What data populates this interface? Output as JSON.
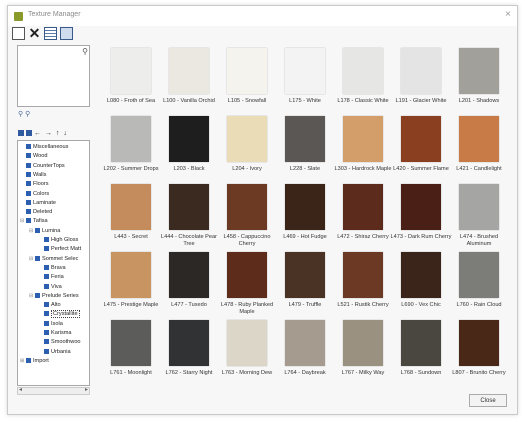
{
  "window": {
    "title": "Texture Manager",
    "close_label": "×",
    "close_button": "Close"
  },
  "toolbar": {
    "new_icon": "new-document-icon",
    "delete_icon": "delete-x-icon",
    "list_icon": "list-view-icon",
    "grid_icon": "grid-view-icon",
    "delete_glyph": "✕"
  },
  "filter": {
    "funnel_glyph": "⚲",
    "icons_glyphs": "⚲⚲"
  },
  "tree_toolbar": {
    "glyphs": "← → ↑ ↓"
  },
  "tree": [
    {
      "label": "Miscellaneous",
      "depth": 0,
      "exp": ""
    },
    {
      "label": "Wood",
      "depth": 0,
      "exp": ""
    },
    {
      "label": "CounterTops",
      "depth": 0,
      "exp": ""
    },
    {
      "label": "Walls",
      "depth": 0,
      "exp": ""
    },
    {
      "label": "Floors",
      "depth": 0,
      "exp": ""
    },
    {
      "label": "Colors",
      "depth": 0,
      "exp": ""
    },
    {
      "label": "Laminate",
      "depth": 0,
      "exp": ""
    },
    {
      "label": "Deleted",
      "depth": 0,
      "exp": ""
    },
    {
      "label": "Tafisa",
      "depth": 0,
      "exp": "⊟"
    },
    {
      "label": "Lumina",
      "depth": 1,
      "exp": "⊟"
    },
    {
      "label": "High Gloss",
      "depth": 2,
      "exp": ""
    },
    {
      "label": "Perfect Matt",
      "depth": 2,
      "exp": ""
    },
    {
      "label": "Sommet Selec",
      "depth": 1,
      "exp": "⊟"
    },
    {
      "label": "Brava",
      "depth": 2,
      "exp": ""
    },
    {
      "label": "Feria",
      "depth": 2,
      "exp": ""
    },
    {
      "label": "Viva",
      "depth": 2,
      "exp": ""
    },
    {
      "label": "Prelude Series",
      "depth": 1,
      "exp": "⊟"
    },
    {
      "label": "Alto",
      "depth": 2,
      "exp": ""
    },
    {
      "label": "Crystallite",
      "depth": 2,
      "exp": "",
      "selected": true
    },
    {
      "label": "Isola",
      "depth": 2,
      "exp": ""
    },
    {
      "label": "Karisma",
      "depth": 2,
      "exp": ""
    },
    {
      "label": "Smoothwoo",
      "depth": 2,
      "exp": ""
    },
    {
      "label": "Urbania",
      "depth": 2,
      "exp": ""
    },
    {
      "label": "Import",
      "depth": 0,
      "exp": "⊞"
    }
  ],
  "textures": [
    {
      "label": "L080 - Froth of Sea",
      "color": "#ededec"
    },
    {
      "label": "L100 - Vanilla Orchid",
      "color": "#ebe8e1"
    },
    {
      "label": "L105 - Snowfall",
      "color": "#f4f3ee"
    },
    {
      "label": "L175 - White",
      "color": "#f3f3f3"
    },
    {
      "label": "L178 - Classic White",
      "color": "#e6e6e4"
    },
    {
      "label": "L191 - Glacier White",
      "color": "#e4e4e4"
    },
    {
      "label": "L201 - Shadows",
      "color": "#a1a09b"
    },
    {
      "label": "L202 - Summer Drops",
      "color": "#b9bab8"
    },
    {
      "label": "L203 - Black",
      "color": "#1e1e1e"
    },
    {
      "label": "L204 - Ivory",
      "color": "#ebdcb8"
    },
    {
      "label": "L228 - Slate",
      "color": "#5a5755"
    },
    {
      "label": "L303 - Hardrock Maple",
      "color": "#d49e6a"
    },
    {
      "label": "L420 - Summer Flame",
      "color": "#8a3f21"
    },
    {
      "label": "L421 - Candlelight",
      "color": "#c87a47"
    },
    {
      "label": "L443 - Secret",
      "color": "#c48b5c"
    },
    {
      "label": "L444 - Chocolate Pear Tree",
      "color": "#3b2a1f"
    },
    {
      "label": "L458 - Cappuccino Cherry",
      "color": "#6c3a22"
    },
    {
      "label": "L469 - Hot Fudge",
      "color": "#3a2518"
    },
    {
      "label": "L472 - Shiraz Cherry",
      "color": "#5c2b1c"
    },
    {
      "label": "L473 - Dark Rum Cherry",
      "color": "#4a2016"
    },
    {
      "label": "L474 - Brushed Aluminum",
      "color": "#a5a5a3"
    },
    {
      "label": "L475 - Prestige Maple",
      "color": "#c89461"
    },
    {
      "label": "L477 - Tuxedo",
      "color": "#2c2825"
    },
    {
      "label": "L478 - Ruby Planked Maple",
      "color": "#5e2c1b"
    },
    {
      "label": "L479 - Truffle",
      "color": "#4a3325"
    },
    {
      "label": "L521 - Rustik Cherry",
      "color": "#6c3a24"
    },
    {
      "label": "L690 - Vex Chic",
      "color": "#3b2419"
    },
    {
      "label": "L760 - Rain Cloud",
      "color": "#7c7d78"
    },
    {
      "label": "L761 - Moonlight",
      "color": "#5c5c5b"
    },
    {
      "label": "L762 - Starry Night",
      "color": "#303234"
    },
    {
      "label": "L763 - Morning Dew",
      "color": "#dcd6c8"
    },
    {
      "label": "L764 - Daybreak",
      "color": "#a59c8f"
    },
    {
      "label": "L767 - Milky Way",
      "color": "#9b9180"
    },
    {
      "label": "L768 - Sundown",
      "color": "#4a4640"
    },
    {
      "label": "L807 - Brunito Cherry",
      "color": "#4a2818"
    }
  ]
}
